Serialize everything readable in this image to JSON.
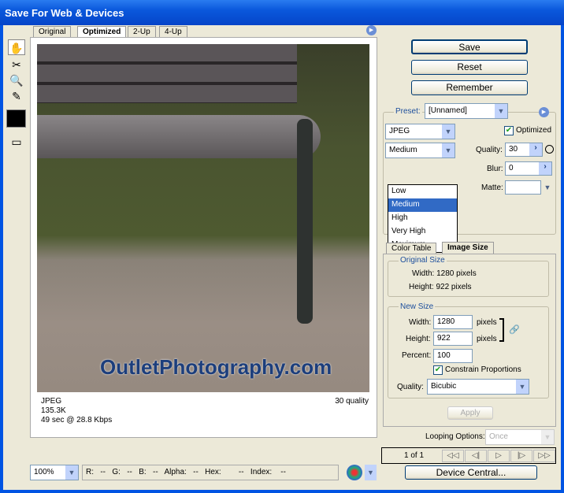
{
  "window": {
    "title": "Save For Web & Devices"
  },
  "tabs": [
    {
      "label": "Original"
    },
    {
      "label": "Optimized"
    },
    {
      "label": "2-Up"
    },
    {
      "label": "4-Up"
    }
  ],
  "image": {
    "watermark": "OutletPhotography.com"
  },
  "info": {
    "format": "JPEG",
    "size": "135.3K",
    "time": "49 sec @ 28.8 Kbps",
    "quality": "30 quality"
  },
  "buttons": {
    "save": "Save",
    "reset": "Reset",
    "remember": "Remember",
    "device_central": "Device Central...",
    "apply": "Apply"
  },
  "preset": {
    "label": "Preset:",
    "value": "[Unnamed]"
  },
  "format": {
    "value": "JPEG"
  },
  "quality_level": {
    "value": "Medium",
    "options": [
      "Low",
      "Medium",
      "High",
      "Very High",
      "Maximum"
    ]
  },
  "optimized": {
    "label": "Optimized",
    "checked": true
  },
  "quality": {
    "label": "Quality:",
    "value": "30"
  },
  "blur": {
    "label": "Blur:",
    "value": "0"
  },
  "matte": {
    "label": "Matte:",
    "value": ""
  },
  "lower_tabs": [
    {
      "label": "Color Table"
    },
    {
      "label": "Image Size"
    }
  ],
  "original_size": {
    "title": "Original Size",
    "width": "Width: 1280 pixels",
    "height": "Height: 922 pixels"
  },
  "new_size": {
    "title": "New Size",
    "width_label": "Width:",
    "width": "1280",
    "height_label": "Height:",
    "height": "922",
    "unit": "pixels",
    "percent_label": "Percent:",
    "percent": "100",
    "constrain": "Constrain Proportions",
    "quality_label": "Quality:",
    "quality": "Bicubic"
  },
  "looping": {
    "label": "Looping Options:",
    "value": "Once"
  },
  "animation": {
    "frame": "1 of 1",
    "controls": [
      "◁◁",
      "◁|",
      "▷",
      "|▷",
      "▷▷"
    ]
  },
  "status": {
    "zoom": "100%",
    "fields": "R:   --   G:   --   B:   --   Alpha:   --   Hex:        --   Index:    --"
  }
}
